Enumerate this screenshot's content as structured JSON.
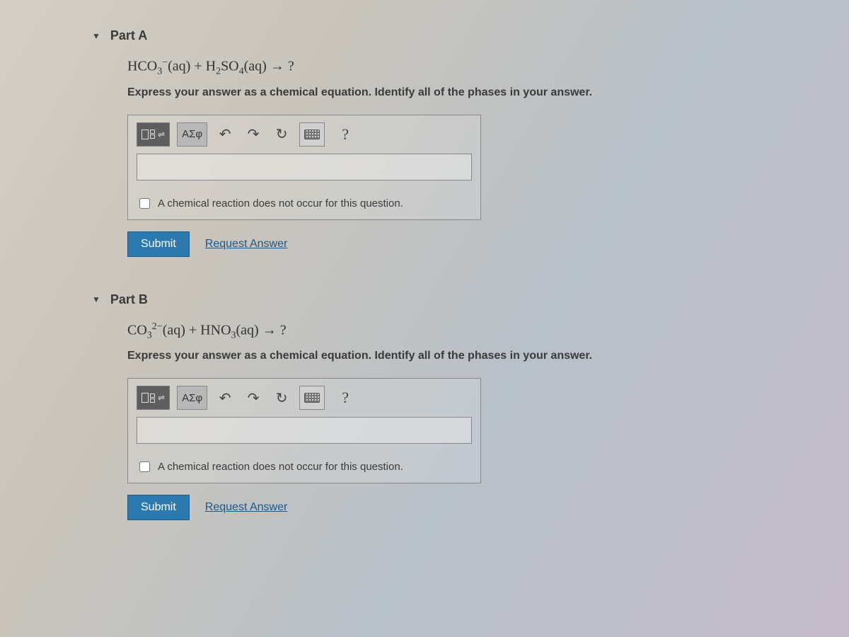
{
  "partA": {
    "title": "Part A",
    "equation_html": "HCO<sub>3</sub><sup>&minus;</sup>(aq) + H<sub>2</sub>SO<sub>4</sub>(aq) &rarr; ?",
    "instruction": "Express your answer as a chemical equation. Identify all of the phases in your answer.",
    "toolbar": {
      "greek_label": "ΑΣφ",
      "help_label": "?"
    },
    "checkbox_label": "A chemical reaction does not occur for this question.",
    "submit_label": "Submit",
    "request_answer_label": "Request Answer"
  },
  "partB": {
    "title": "Part B",
    "equation_html": "CO<sub>3</sub><sup>2&minus;</sup>(aq) + HNO<sub>3</sub>(aq) &rarr; ?",
    "instruction": "Express your answer as a chemical equation. Identify all of the phases in your answer.",
    "toolbar": {
      "greek_label": "ΑΣφ",
      "help_label": "?"
    },
    "checkbox_label": "A chemical reaction does not occur for this question.",
    "submit_label": "Submit",
    "request_answer_label": "Request Answer"
  }
}
